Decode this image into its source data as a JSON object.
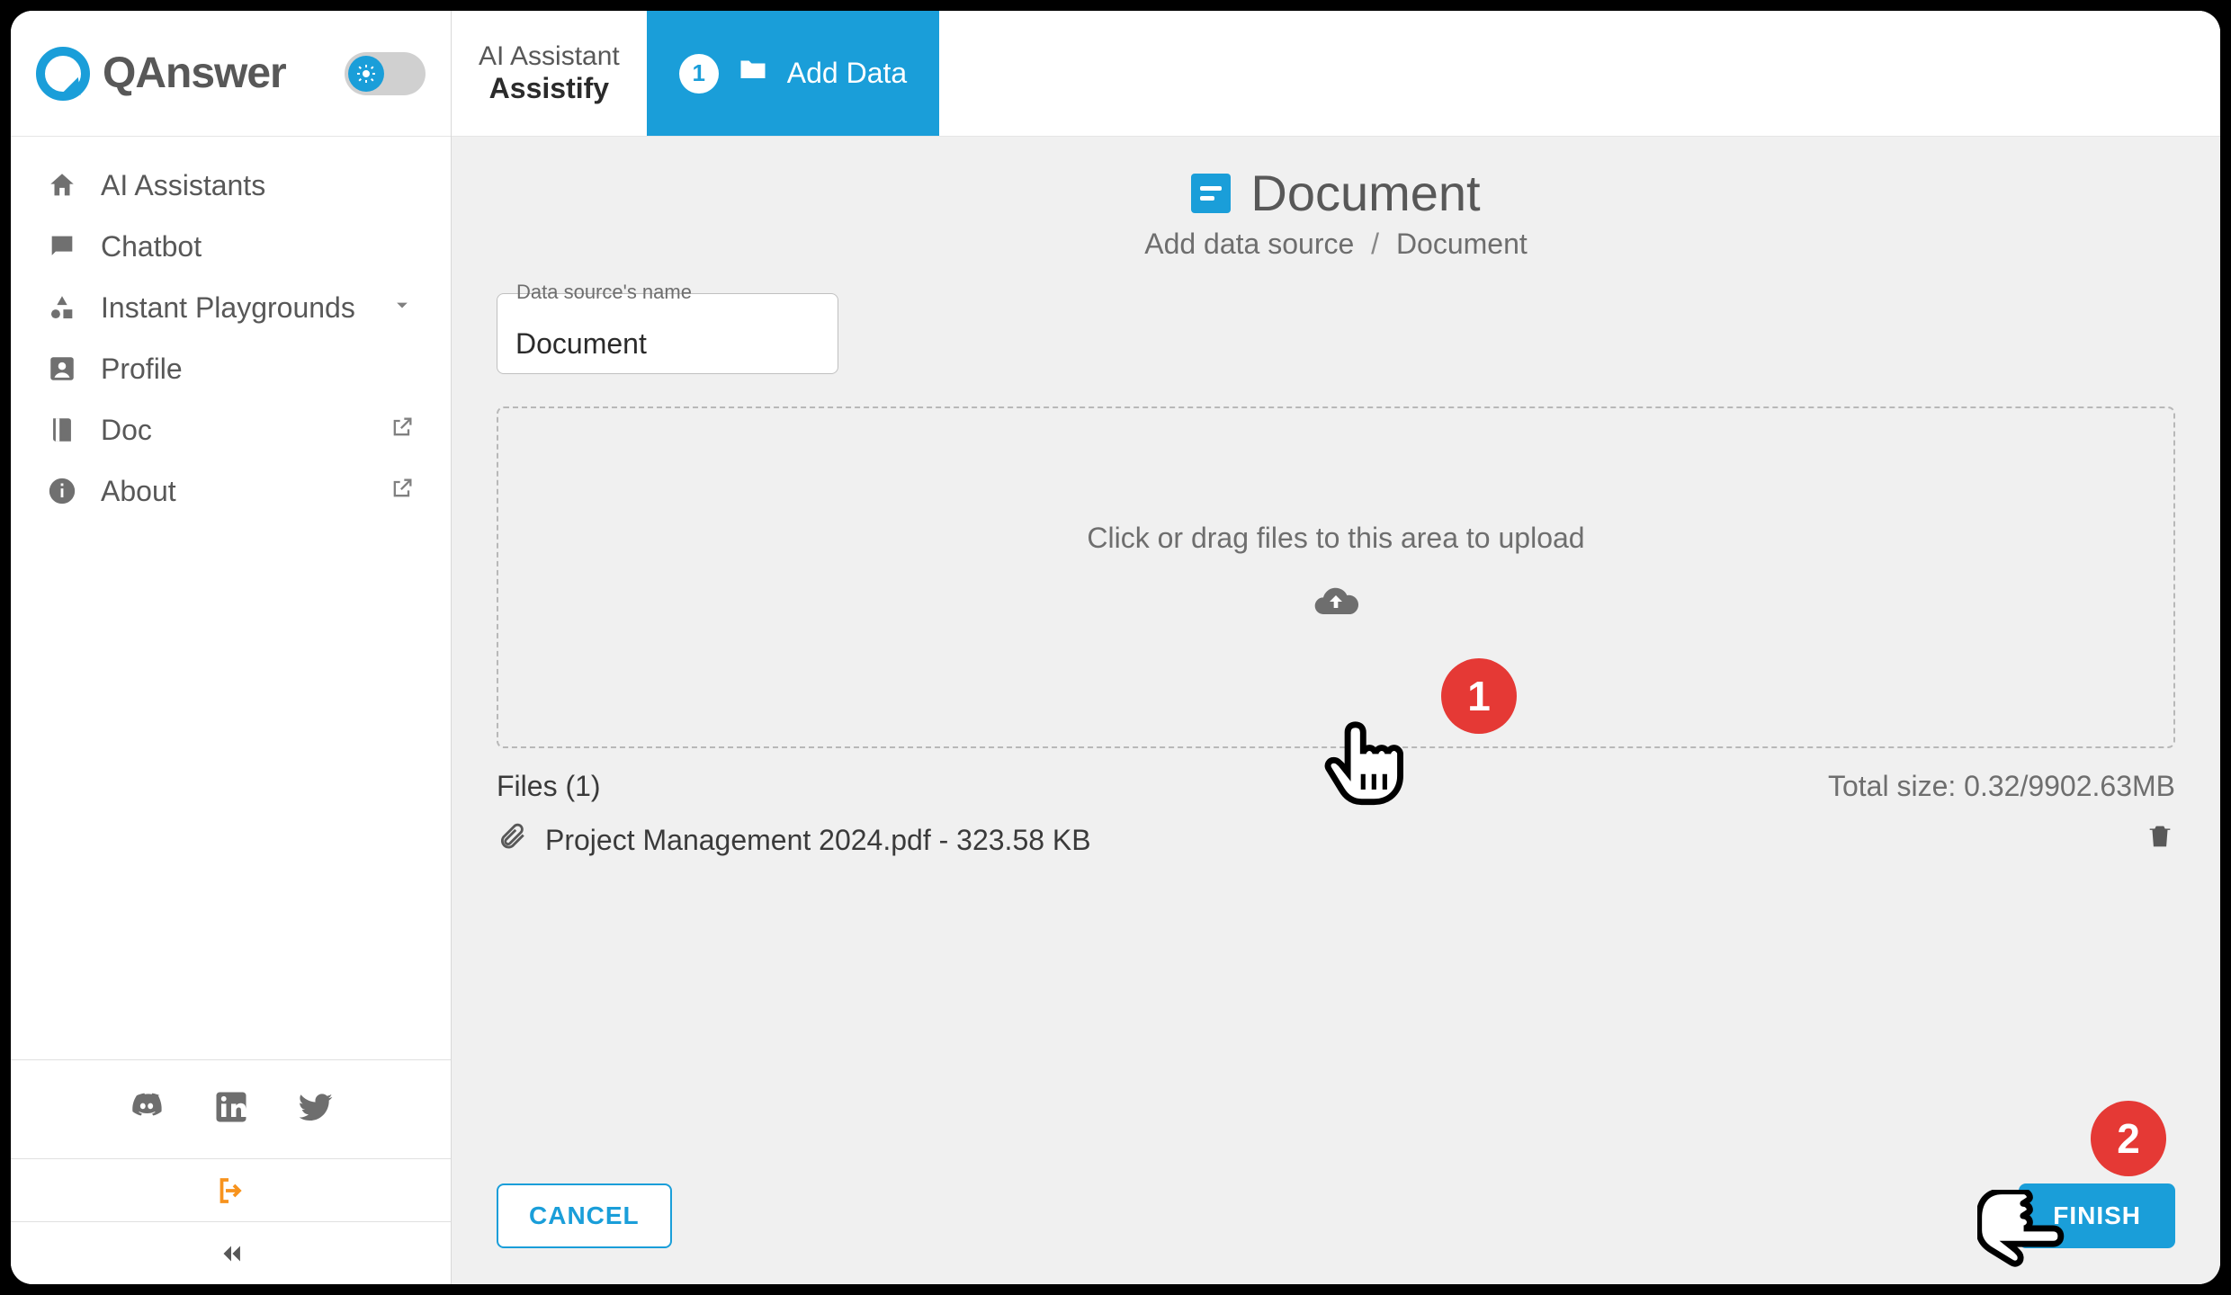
{
  "brand": {
    "name": "QAnswer"
  },
  "sidebar": {
    "items": [
      {
        "label": "AI Assistants"
      },
      {
        "label": "Chatbot"
      },
      {
        "label": "Instant Playgrounds"
      },
      {
        "label": "Profile"
      },
      {
        "label": "Doc"
      },
      {
        "label": "About"
      }
    ]
  },
  "topbar": {
    "assistant_label": "AI Assistant",
    "assistant_name": "Assistify",
    "step_number": "1",
    "step_label": "Add Data"
  },
  "page": {
    "title": "Document",
    "breadcrumb_root": "Add data source",
    "breadcrumb_sep": "/",
    "breadcrumb_leaf": "Document"
  },
  "datasource": {
    "field_label": "Data source's name",
    "name_value": "Document"
  },
  "dropzone": {
    "hint": "Click or drag files to this area to upload"
  },
  "files": {
    "count_label": "Files (1)",
    "total_size_label": "Total size: 0.32/9902.63MB",
    "items": [
      {
        "display": "Project Management 2024.pdf - 323.58 KB"
      }
    ]
  },
  "actions": {
    "cancel": "CANCEL",
    "finish": "FINISH"
  },
  "annotations": {
    "badge1": "1",
    "badge2": "2"
  }
}
